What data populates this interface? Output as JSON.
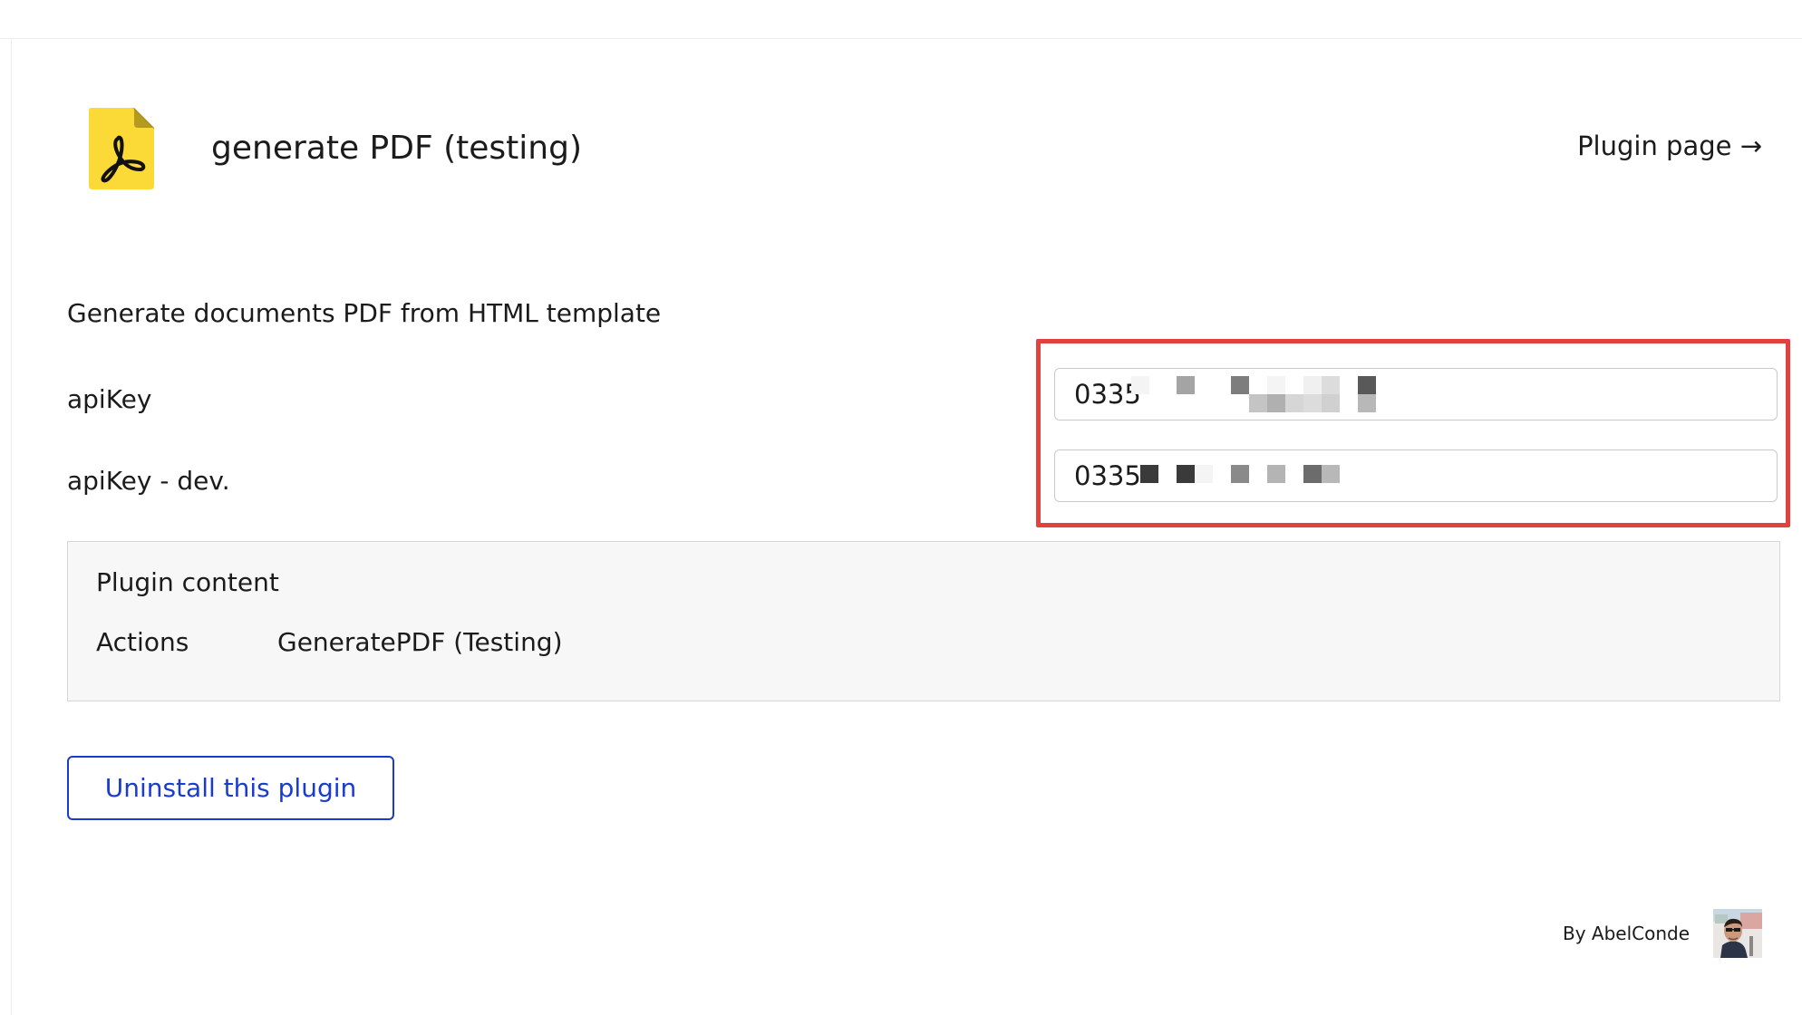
{
  "plugin": {
    "title": "generate PDF (testing)",
    "page_link": "Plugin page →",
    "description": "Generate documents PDF from HTML template",
    "icon": "pdf-file-icon",
    "icon_color": "#fbd936"
  },
  "settings": {
    "apikey_label": "apiKey",
    "apikey_value": "0335",
    "apikey_dev_label": "apiKey - dev.",
    "apikey_dev_value": "0335",
    "highlight_color": "#e0423f"
  },
  "content": {
    "heading": "Plugin content",
    "actions_label": "Actions",
    "actions_value": "GeneratePDF (Testing)"
  },
  "uninstall_label": "Uninstall this plugin",
  "author": {
    "label": "By AbelConde",
    "avatar_icon": "author-avatar"
  },
  "colors": {
    "link_blue": "#1a3bd1",
    "panel_bg": "#f7f7f7"
  }
}
